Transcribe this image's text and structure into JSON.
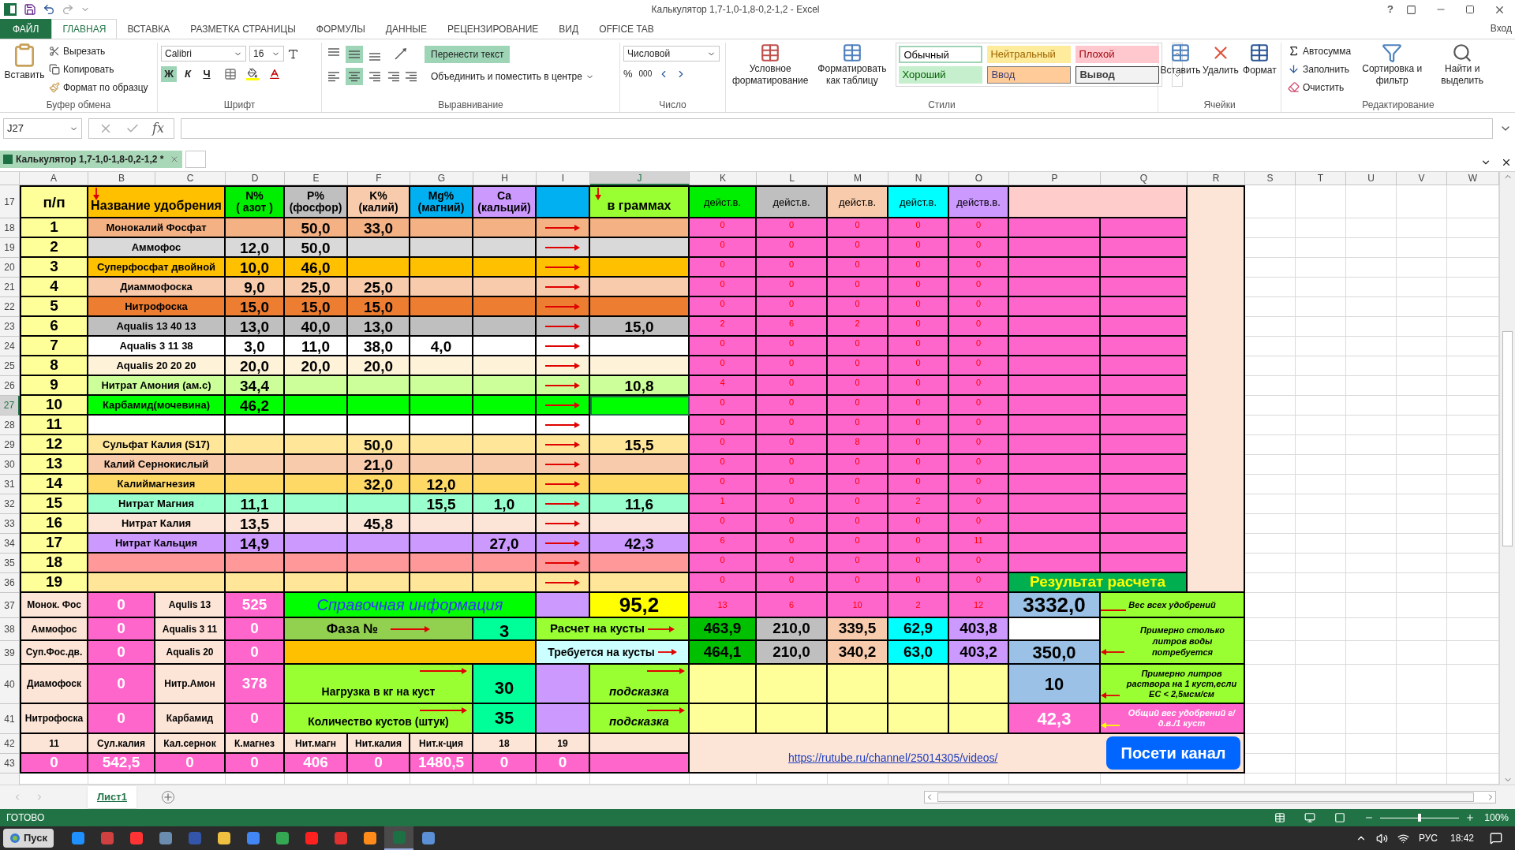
{
  "window": {
    "title": "Калькулятор 1,7-1,0-1,8-0,2-1,2 - Excel",
    "help": "?",
    "account": "Вход"
  },
  "ribbon_tabs": [
    {
      "label": "ФАЙЛ",
      "kind": "file",
      "selected": false
    },
    {
      "label": "ГЛАВНАЯ",
      "kind": "tab",
      "selected": true
    },
    {
      "label": "ВСТАВКА",
      "kind": "tab",
      "selected": false
    },
    {
      "label": "РАЗМЕТКА СТРАНИЦЫ",
      "kind": "tab",
      "selected": false
    },
    {
      "label": "ФОРМУЛЫ",
      "kind": "tab",
      "selected": false
    },
    {
      "label": "ДАННЫЕ",
      "kind": "tab",
      "selected": false
    },
    {
      "label": "РЕЦЕНЗИРОВАНИЕ",
      "kind": "tab",
      "selected": false
    },
    {
      "label": "ВИД",
      "kind": "tab",
      "selected": false
    },
    {
      "label": "OFFICE TAB",
      "kind": "tab",
      "selected": false
    }
  ],
  "ribbon": {
    "clipboard": {
      "label": "Буфер обмена",
      "paste": "Вставить",
      "cut": "Вырезать",
      "copy": "Копировать",
      "format_painter": "Формат по образцу"
    },
    "font": {
      "label": "Шрифт",
      "family": "Calibri",
      "size": "16",
      "styles": [
        {
          "text": "Ж",
          "on": true
        },
        {
          "text": "К",
          "on": false
        },
        {
          "text": "Ч",
          "on": false
        }
      ]
    },
    "alignment": {
      "label": "Выравнивание",
      "vertical": [
        {
          "selected": false
        },
        {
          "selected": true
        },
        {
          "selected": false
        }
      ],
      "horizontal": [
        {
          "selected": false
        },
        {
          "selected": true
        },
        {
          "selected": false
        }
      ],
      "wrap_text": {
        "text": "Перенести текст",
        "on": true
      },
      "merge": "Объединить и поместить в центре"
    },
    "number": {
      "label": "Число",
      "format": "Числовой",
      "percent": "%",
      "thousands": "000"
    },
    "styles": {
      "label": "Стили",
      "conditional": "Условное форматирование",
      "as_table": "Форматировать как таблицу",
      "gallery": [
        {
          "text": "Обычный",
          "kind": "normal"
        },
        {
          "text": "Нейтральный",
          "kind": "neutral"
        },
        {
          "text": "Плохой",
          "kind": "bad"
        },
        {
          "text": "Хороший",
          "kind": "good"
        },
        {
          "text": "Ввод",
          "kind": "input"
        },
        {
          "text": "Вывод",
          "kind": "output"
        }
      ]
    },
    "cells": {
      "label": "Ячейки",
      "insert": "Вставить",
      "delete": "Удалить",
      "format": "Формат"
    },
    "editing": {
      "label": "Редактирование",
      "autosum": "Автосумма",
      "fill": "Заполнить",
      "clear": "Очистить",
      "sort": "Сортировка и фильтр",
      "find": "Найти и выделить"
    }
  },
  "formula_bar": {
    "name_box": "J27",
    "function_symbol": "fx"
  },
  "workbook_tab": {
    "label": "Калькулятор 1,7-1,0-1,8-0,2-1,2 *"
  },
  "sheet": {
    "columns": [
      {
        "label": "A",
        "selected": false
      },
      {
        "label": "B",
        "selected": false
      },
      {
        "label": "C",
        "selected": false
      },
      {
        "label": "D",
        "selected": false
      },
      {
        "label": "E",
        "selected": false
      },
      {
        "label": "F",
        "selected": false
      },
      {
        "label": "G",
        "selected": false
      },
      {
        "label": "H",
        "selected": false
      },
      {
        "label": "I",
        "selected": false
      },
      {
        "label": "J",
        "selected": true
      },
      {
        "label": "K",
        "selected": false
      },
      {
        "label": "L",
        "selected": false
      },
      {
        "label": "M",
        "selected": false
      },
      {
        "label": "N",
        "selected": false
      },
      {
        "label": "O",
        "selected": false
      },
      {
        "label": "P",
        "selected": false
      },
      {
        "label": "Q",
        "selected": false
      },
      {
        "label": "R",
        "selected": false
      },
      {
        "label": "S",
        "selected": false
      },
      {
        "label": "T",
        "selected": false
      },
      {
        "label": "U",
        "selected": false
      },
      {
        "label": "V",
        "selected": false
      },
      {
        "label": "W",
        "selected": false
      }
    ],
    "header": {
      "number": "17",
      "cells": [
        {
          "text": "п/п",
          "color": "#ffff99"
        },
        {
          "text": "Название удобрения",
          "color": "#ffc000"
        },
        {
          "text": "N%\n( азот )",
          "color": "#00ee00"
        },
        {
          "text": "P%\n(фосфор)",
          "color": "#bfbfbf"
        },
        {
          "text": "K%\n(калий)",
          "color": "#f8cbad"
        },
        {
          "text": "Mg%\n(магний)",
          "color": "#00b0f0"
        },
        {
          "text": "Ca\n(кальций)",
          "color": "#cc99ff"
        },
        {
          "color": "#00b0f0"
        },
        {
          "text": "в граммах",
          "color": "#99ff33"
        },
        {
          "text": "дейст.в.",
          "color": "#00ee00"
        },
        {
          "text": "дейст.в.",
          "color": "#bfbfbf"
        },
        {
          "text": "дейст.в.",
          "color": "#f8cbad"
        },
        {
          "text": "дейст.в.",
          "color": "#00ffff"
        },
        {
          "text": "действ.в.",
          "color": "#cc99ff"
        },
        {
          "color": "#ffcccc"
        },
        {
          "color": "#fce4d6"
        }
      ]
    },
    "rows": [
      {
        "number": "18",
        "index": "1",
        "name": "Монокалий Фосфат",
        "color": "#f4b183",
        "values": {
          "p": "50,0",
          "k": "33,0"
        },
        "active": [
          "0",
          "0",
          "0",
          "0",
          "0"
        ],
        "selected": false
      },
      {
        "number": "19",
        "index": "2",
        "name": "Аммофос",
        "color": "#d9d9d9",
        "values": {
          "n": "12,0",
          "p": "50,0"
        },
        "active": [
          "0",
          "0",
          "0",
          "0",
          "0"
        ],
        "selected": false
      },
      {
        "number": "20",
        "index": "3",
        "name": "Суперфосфат двойной",
        "color": "#ffc000",
        "values": {
          "n": "10,0",
          "p": "46,0"
        },
        "active": [
          "0",
          "0",
          "0",
          "0",
          "0"
        ],
        "selected": false
      },
      {
        "number": "21",
        "index": "4",
        "name": "Диаммофоска",
        "color": "#f8cbad",
        "values": {
          "n": "9,0",
          "p": "25,0",
          "k": "25,0"
        },
        "active": [
          "0",
          "0",
          "0",
          "0",
          "0"
        ],
        "selected": false
      },
      {
        "number": "22",
        "index": "5",
        "name": "Нитрофоска",
        "color": "#ed7d31",
        "values": {
          "n": "15,0",
          "p": "15,0",
          "k": "15,0"
        },
        "active": [
          "0",
          "0",
          "0",
          "0",
          "0"
        ],
        "selected": false
      },
      {
        "number": "23",
        "index": "6",
        "name": "Aqualis 13 40 13",
        "color": "#bfbfbf",
        "values": {
          "n": "13,0",
          "p": "40,0",
          "k": "13,0"
        },
        "grams": "15,0",
        "active": [
          "2",
          "6",
          "2",
          "0",
          "0"
        ],
        "selected": false
      },
      {
        "number": "24",
        "index": "7",
        "name": "Aqualis 3 11 38",
        "color": "#ffffff",
        "values": {
          "n": "3,0",
          "p": "11,0",
          "k": "38,0",
          "mg": "4,0"
        },
        "active": [
          "0",
          "0",
          "0",
          "0",
          "0"
        ],
        "selected": false
      },
      {
        "number": "25",
        "index": "8",
        "name": "Aqualis 20 20 20",
        "color": "#fef2d9",
        "values": {
          "n": "20,0",
          "p": "20,0",
          "k": "20,0"
        },
        "active": [
          "0",
          "0",
          "0",
          "0",
          "0"
        ],
        "selected": false
      },
      {
        "number": "26",
        "index": "9",
        "name": "Нитрат Амония (ам.с)",
        "color": "#ccff99",
        "values": {
          "n": "34,4"
        },
        "grams": "10,8",
        "active": [
          "4",
          "0",
          "0",
          "0",
          "0"
        ],
        "selected": false
      },
      {
        "number": "27",
        "index": "10",
        "name": "Карбамид(мочевина)",
        "color": "#00ff00",
        "values": {
          "n": "46,2"
        },
        "active": [
          "0",
          "0",
          "0",
          "0",
          "0"
        ],
        "selected": true
      },
      {
        "number": "28",
        "index": "11",
        "color": "#ffffff",
        "active": [
          "0",
          "0",
          "0",
          "0",
          "0"
        ],
        "selected": false
      },
      {
        "number": "29",
        "index": "12",
        "name": "Сульфат Калия (S17)",
        "color": "#ffe699",
        "values": {
          "k": "50,0"
        },
        "grams": "15,5",
        "active": [
          "0",
          "0",
          "8",
          "0",
          "0"
        ],
        "selected": false
      },
      {
        "number": "30",
        "index": "13",
        "name": "Калий Сернокислый",
        "color": "#f8cbad",
        "values": {
          "k": "21,0"
        },
        "active": [
          "0",
          "0",
          "0",
          "0",
          "0"
        ],
        "selected": false
      },
      {
        "number": "31",
        "index": "14",
        "name": "Калиймагнезия",
        "color": "#ffd966",
        "values": {
          "k": "32,0",
          "mg": "12,0"
        },
        "active": [
          "0",
          "0",
          "0",
          "0",
          "0"
        ],
        "selected": false
      },
      {
        "number": "32",
        "index": "15",
        "name": "Нитрат Магния",
        "color": "#99ffcc",
        "values": {
          "n": "11,1",
          "mg": "15,5",
          "ca": "1,0"
        },
        "grams": "11,6",
        "active": [
          "1",
          "0",
          "0",
          "2",
          "0"
        ],
        "selected": false
      },
      {
        "number": "33",
        "index": "16",
        "name": "Нитрат Калия",
        "color": "#fce4d6",
        "values": {
          "n": "13,5",
          "k": "45,8"
        },
        "active": [
          "0",
          "0",
          "0",
          "0",
          "0"
        ],
        "selected": false
      },
      {
        "number": "34",
        "index": "17",
        "name": "Нитрат Кальция",
        "color": "#cc99ff",
        "values": {
          "n": "14,9",
          "ca": "27,0"
        },
        "grams": "42,3",
        "active": [
          "6",
          "0",
          "0",
          "0",
          "11"
        ],
        "selected": false
      },
      {
        "number": "35",
        "index": "18",
        "color": "#ff9999",
        "active": [
          "0",
          "0",
          "0",
          "0",
          "0"
        ],
        "selected": false
      },
      {
        "number": "36",
        "index": "19",
        "color": "#ffe699",
        "active": [
          "0",
          "0",
          "0",
          "0",
          "0"
        ],
        "selected": false
      }
    ],
    "result_title": "Результат расчета"
  },
  "summary": {
    "rows": [
      {
        "number": "37",
        "a": "Монок. Фос",
        "b": "0",
        "c": "Aqulis 13",
        "d": "525"
      },
      {
        "number": "38",
        "a": "Аммофос",
        "b": "0",
        "c": "Aqualis 3 11",
        "d": "0"
      },
      {
        "number": "39",
        "a": "Суп.Фос.дв.",
        "b": "0",
        "c": "Aqualis 20",
        "d": "0"
      },
      {
        "number": "40",
        "a": "Диамофоск",
        "b": "0",
        "c": "Нитр.Амон",
        "d": "378"
      },
      {
        "number": "41",
        "a": "Нитрофоска",
        "b": "0",
        "c": "Карбамид",
        "d": "0"
      }
    ],
    "reference": "Справочная информация",
    "phase_label": "Фаза №",
    "phase": "3",
    "load_label": "Нагрузка в кг на куст",
    "load": "30",
    "count_label": "Количество кустов (штук)",
    "count": "35",
    "total_grams": "95,2",
    "active_totals": [
      "13",
      "6",
      "10",
      "2",
      "12"
    ],
    "calc_label": "Расчет на кусты",
    "calc": [
      "463,9",
      "210,0",
      "339,5",
      "62,9",
      "403,8"
    ],
    "required_label": "Требуется на кусты",
    "required": [
      "464,1",
      "210,0",
      "340,2",
      "63,0",
      "403,2"
    ],
    "hints": [
      "подсказка",
      "подсказка"
    ],
    "results": [
      {
        "value": "3332,0",
        "note": "Вес всех удобрений"
      },
      {
        "value": "350,0",
        "note": "Примерно столько литров воды потребуется"
      },
      {
        "value": "10",
        "note": "Примерно литров раствора на 1 куст,если EC < 2,5мсм/см"
      },
      {
        "value": "42,3",
        "note": "Общий вес удобрений г/д.в./1 куст"
      }
    ],
    "labels_row": {
      "number": "42",
      "cells": [
        "11",
        "Сул.калия",
        "Кал.сернок",
        "К.магнез",
        "Нит.магн",
        "Нит.калия",
        "Нит.к-ция",
        "18",
        "19"
      ]
    },
    "values_row": {
      "number": "43",
      "cells": [
        "0",
        "542,5",
        "0",
        "0",
        "406",
        "0",
        "1480,5",
        "0",
        "0"
      ]
    },
    "link": "https://rutube.ru/channel/25014305/videos/",
    "channel_button": "Посети канал"
  },
  "sheet_tabs": [
    {
      "label": "Лист1",
      "selected": true
    }
  ],
  "status_bar": {
    "status": "ГОТОВО",
    "zoom": "100%",
    "zoom_level": {
      "level": 0.5
    }
  },
  "taskbar": {
    "start": "Пуск",
    "apps": [
      {
        "color": "#1e90ff",
        "selected": false
      },
      {
        "color": "#d04040",
        "selected": false
      },
      {
        "color": "#ff3333",
        "selected": false
      },
      {
        "color": "#6a8caf",
        "selected": false
      },
      {
        "color": "#3355aa",
        "selected": false
      },
      {
        "color": "#f0c040",
        "selected": false
      },
      {
        "color": "#4285f4",
        "selected": false
      },
      {
        "color": "#34a853",
        "selected": false
      },
      {
        "color": "#ff2020",
        "selected": false
      },
      {
        "color": "#e03030",
        "selected": false
      },
      {
        "color": "#ff8c1a",
        "selected": false
      },
      {
        "color": "#1d7044",
        "selected": true
      },
      {
        "color": "#5b8fd6",
        "selected": false
      }
    ],
    "language": "РУС",
    "time": "18:42"
  }
}
